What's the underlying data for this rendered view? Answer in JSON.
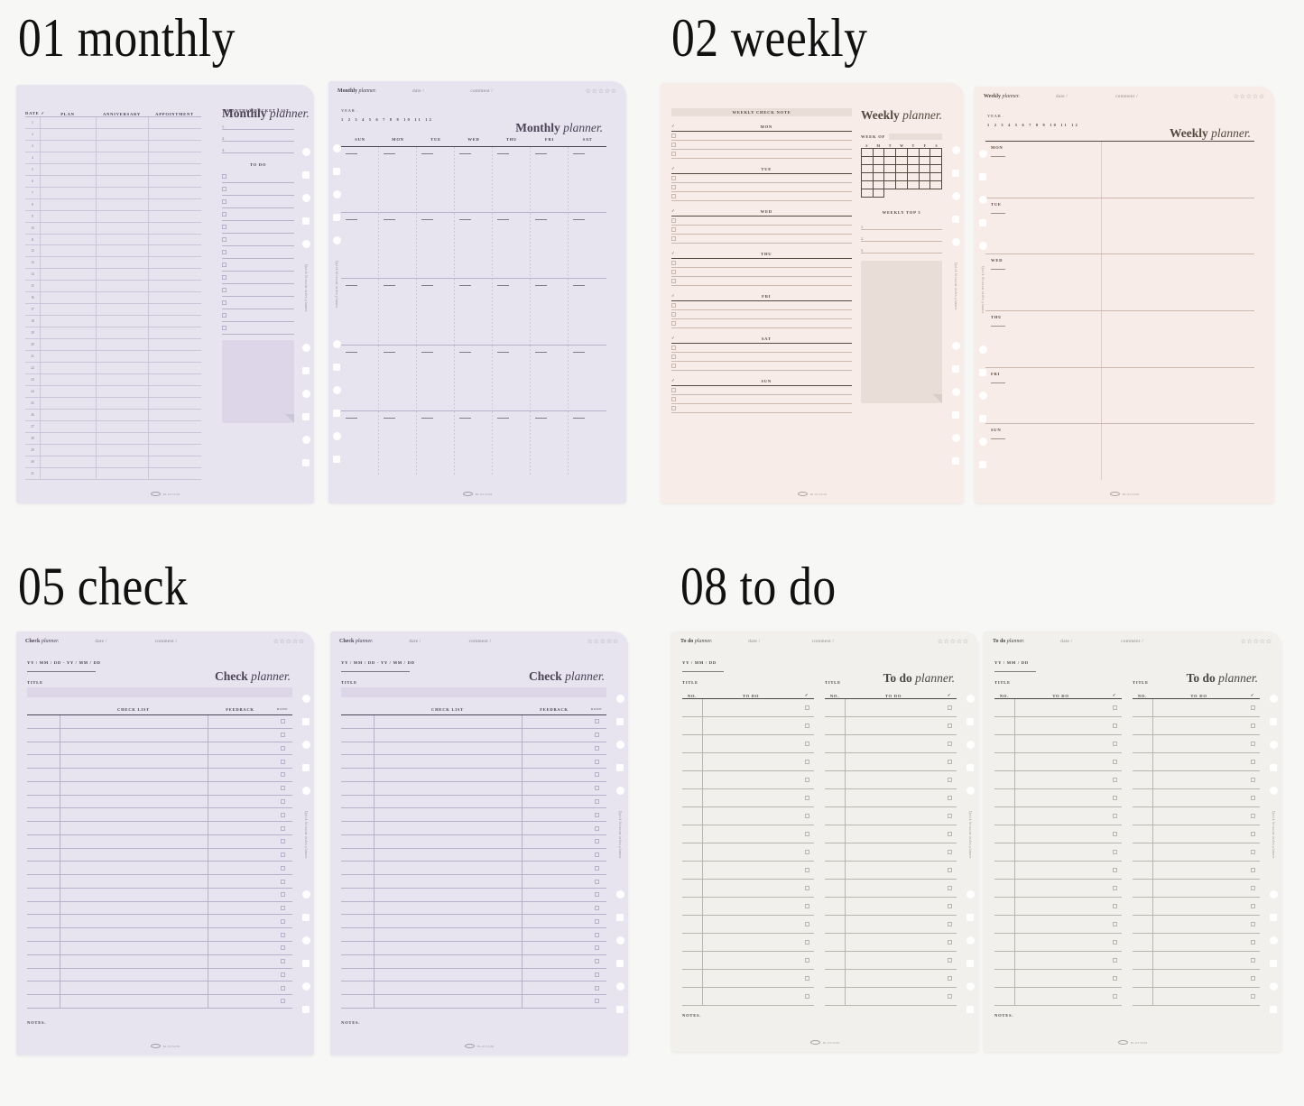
{
  "page": {
    "background": "#f7f7f6"
  },
  "sections": [
    {
      "id": "monthly",
      "number": "01",
      "name": "monthly",
      "title": "01 monthly",
      "color": "#e7e3ef"
    },
    {
      "id": "weekly",
      "number": "02",
      "name": "weekly",
      "title": "02 weekly",
      "color": "#f7ece7"
    },
    {
      "id": "check",
      "number": "05",
      "name": "check",
      "title": "05 check",
      "color": "#e7e3ef"
    },
    {
      "id": "todo",
      "number": "08",
      "name": "to do",
      "title": "08 to do",
      "color": "#f1f0ed"
    }
  ],
  "common": {
    "stars": "☆☆☆☆☆",
    "date_field": "date /",
    "comment_field": "comment /",
    "year_label": "Year .",
    "months": "1  2  3  4  5  6  7  8  9  10  11  12",
    "side_text": "Quick blossom index planner",
    "watermark": "BLOSSOM",
    "checkmark": "✓",
    "notes_label": "NOTES."
  },
  "monthly": {
    "brand": {
      "bold": "Monthly",
      "italic": "planner."
    },
    "big_title": {
      "bold": "Monthly",
      "italic": "planner."
    },
    "page1": {
      "columns": [
        "DATE  ✓",
        "PLAN",
        "ANNIVERSARY",
        "APPOINTMENT"
      ],
      "day_numbers": [
        "1",
        "2",
        "3",
        "4",
        "5",
        "6",
        "7",
        "8",
        "9",
        "10",
        "11",
        "12",
        "13",
        "14",
        "15",
        "16",
        "17",
        "18",
        "19",
        "20",
        "21",
        "22",
        "23",
        "24",
        "25",
        "26",
        "27",
        "28",
        "29",
        "30",
        "31"
      ],
      "bucket_heading": "MONTHLY BUCKET LIST",
      "bucket_items": [
        "1.",
        "2.",
        "3."
      ],
      "todo_heading": "TO DO",
      "todo_rows": 13
    },
    "page2": {
      "weekdays": [
        "SUN",
        "MON",
        "TUE",
        "WED",
        "THU",
        "FRI",
        "SAT"
      ],
      "weeks": 5
    }
  },
  "weekly": {
    "brand": {
      "bold": "Weekly",
      "italic": "planner."
    },
    "big_title": {
      "bold": "Weekly",
      "italic": "planner."
    },
    "page1": {
      "banner": "WEEKLY CHECK NOTE",
      "days": [
        "MON",
        "TUE",
        "WED",
        "THU",
        "FRI",
        "SAT",
        "SUN"
      ],
      "lines_per_day": 3,
      "week_of_label": "Week of",
      "mini_cal_headers": [
        "S",
        "M",
        "T",
        "W",
        "T",
        "F",
        "S"
      ],
      "mini_cal_rows": 6,
      "top3_heading": "WEEKLY TOP 3",
      "top3_items": [
        "1.",
        "2.",
        "3."
      ]
    },
    "page2": {
      "days": [
        "MON",
        "TUE",
        "WED",
        "THU",
        "FRI",
        "SUN"
      ]
    }
  },
  "check": {
    "brand": {
      "bold": "Check",
      "italic": "planner."
    },
    "big_title": {
      "bold": "Check",
      "italic": "planner."
    },
    "date_range": "YY / MM / DD   -   YY / MM / DD",
    "title_label": "TITLE",
    "columns": [
      "CHECK LIST",
      "FEEDBACK",
      "DONE"
    ],
    "rows": 22
  },
  "todo": {
    "brand": {
      "bold": "To do",
      "italic": "planner."
    },
    "big_title": {
      "bold": "To do",
      "italic": "planner."
    },
    "date": "YY / MM / DD",
    "title_label": "TITLE",
    "columns": [
      "NO.",
      "TO DO",
      "✓"
    ],
    "rows": 17
  }
}
